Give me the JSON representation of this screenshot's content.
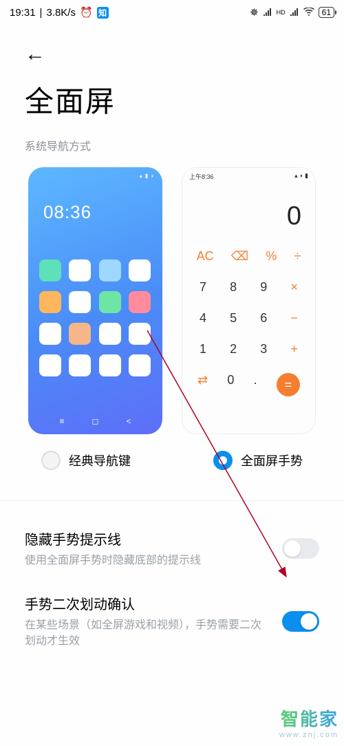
{
  "status": {
    "time": "19:31",
    "speed": "3.8K/s",
    "battery": "61"
  },
  "page": {
    "title": "全面屏",
    "section_label": "系统导航方式"
  },
  "preview_classic": {
    "time": "08:36"
  },
  "preview_gesture": {
    "status_time": "上午8:36",
    "display": "0",
    "keys_r1": [
      "AC",
      "⌫",
      "%",
      "÷"
    ],
    "keys_r2": [
      "7",
      "8",
      "9",
      "×"
    ],
    "keys_r3": [
      "4",
      "5",
      "6",
      "−"
    ],
    "keys_r4": [
      "1",
      "2",
      "3",
      "+"
    ],
    "keys_r5": [
      "⇄",
      "0",
      ".",
      "="
    ]
  },
  "nav_options": {
    "classic": "经典导航键",
    "gesture": "全面屏手势"
  },
  "settings": {
    "hide_hint": {
      "title": "隐藏手势提示线",
      "desc": "使用全面屏手势时隐藏底部的提示线"
    },
    "double_swipe": {
      "title": "手势二次划动确认",
      "desc": "在某些场景（如全屏游戏和视频），手势需要二次划动才生效"
    }
  },
  "watermark": {
    "main": "智能家",
    "sub": "www.znj.com"
  },
  "icon_colors": [
    "#5ee0b8",
    "#ffffff",
    "#9fd8ff",
    "#ffffff",
    "#ffb75e",
    "#ffffff",
    "#6de6a5",
    "#ff8b9c",
    "#ffffff",
    "#f5b78a",
    "#ffffff",
    "#ffffff",
    "#ffffff",
    "#ffffff",
    "#ffffff",
    "#ffffff"
  ]
}
